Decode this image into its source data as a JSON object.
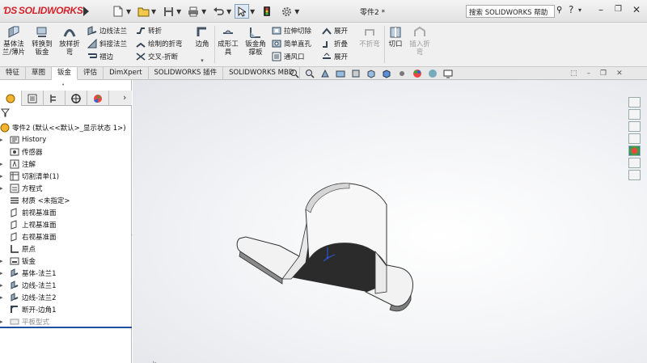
{
  "app": {
    "brand": "SOLIDWORKS",
    "part_name": "零件2 *"
  },
  "titlebar": {
    "search_text": "搜索 SOLIDWORKS 帮助",
    "quick_access": [
      "new-icon",
      "open-icon",
      "save-icon",
      "print-icon",
      "undo-icon",
      "select-icon",
      "rebuild-icon",
      "options-icon"
    ]
  },
  "ribbon": {
    "base_flange": "基体法兰/薄片",
    "convert_sheet": "转换到钣金",
    "lofted_bend": "放样折弯",
    "edge_flange": "边线法兰",
    "miter_flange": "斜接法兰",
    "hem": "褶边",
    "jog": "转折",
    "sketched_bend": "绘制的折弯",
    "cross_break": "交叉-折断",
    "corners": "边角",
    "forming_tool": "成形工具",
    "gusset": "钣金角撑板",
    "extruded_cut": "拉伸切除",
    "simple_hole": "简单直孔",
    "vent": "通风口",
    "unfold": "展开",
    "fold": "折叠",
    "flatten": "展开",
    "no_bends": "不折弯",
    "rip": "切口",
    "insert_bends": "插入折弯"
  },
  "tabs": [
    {
      "label": "特征",
      "active": false
    },
    {
      "label": "草图",
      "active": false
    },
    {
      "label": "钣金",
      "active": true
    },
    {
      "label": "评估",
      "active": false
    },
    {
      "label": "DimXpert",
      "active": false
    },
    {
      "label": "SOLIDWORKS 插件",
      "active": false
    },
    {
      "label": "SOLIDWORKS MBD",
      "active": false
    }
  ],
  "tree": {
    "root": "零件2 (默认<<默认>_显示状态 1>)",
    "items": [
      {
        "label": "History"
      },
      {
        "label": "传感器"
      },
      {
        "label": "注解"
      },
      {
        "label": "切割清单(1)"
      },
      {
        "label": "方程式"
      },
      {
        "label": "材质 <未指定>"
      },
      {
        "label": "前视基准面"
      },
      {
        "label": "上视基准面"
      },
      {
        "label": "右视基准面"
      },
      {
        "label": "原点"
      },
      {
        "label": "钣金"
      },
      {
        "label": "基体-法兰1"
      },
      {
        "label": "边线-法兰1"
      },
      {
        "label": "边线-法兰2"
      },
      {
        "label": "断开-边角1"
      },
      {
        "label": "平板型式"
      }
    ]
  },
  "colors": {
    "brand_red": "#d2232a",
    "ribbon_bg": "#f0f0f0",
    "selection_blue": "#1f4f9e",
    "part_shadow": "#2b2b2b"
  }
}
